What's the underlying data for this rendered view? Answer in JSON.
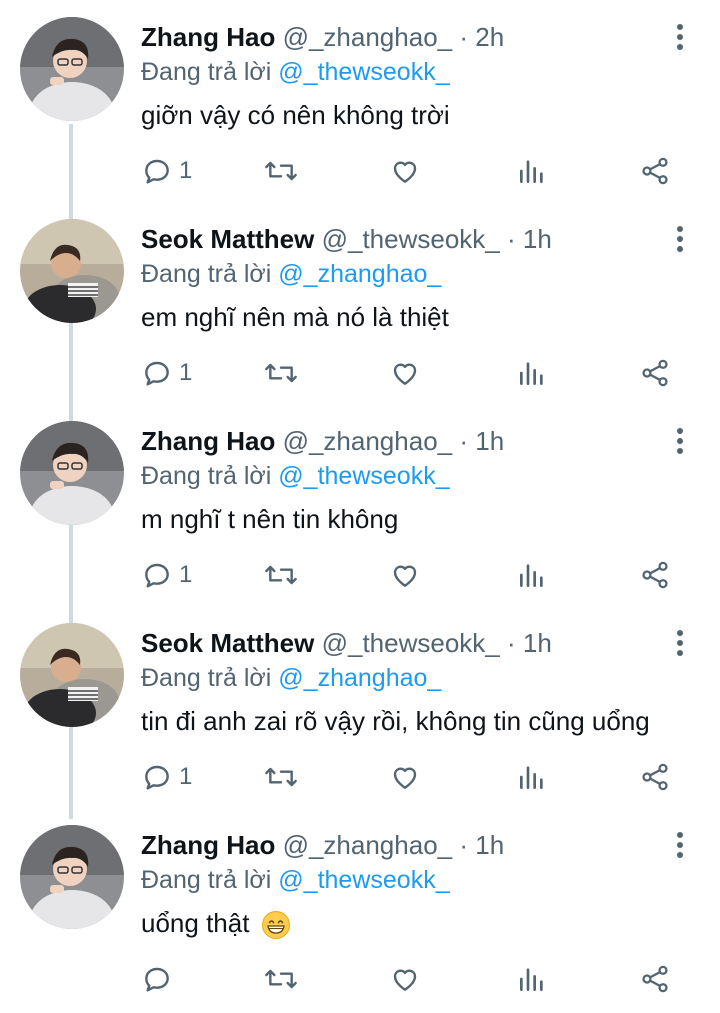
{
  "colors": {
    "accent": "#1d9bf0",
    "secondary_text": "#536471",
    "thread_line": "#cfd9de"
  },
  "reply_prefix": "Đang trả lời",
  "tweets": [
    {
      "name": "Zhang Hao",
      "handle": "@_zhanghao_",
      "separator": "·",
      "time": "2h",
      "replying_to": "@_thewseokk_",
      "text": "giỡn vậy có nên không trời",
      "reply_count": "1",
      "avatar": "zhang-hao-avatar"
    },
    {
      "name": "Seok Matthew",
      "handle": "@_thewseokk_",
      "separator": "·",
      "time": "1h",
      "replying_to": "@_zhanghao_",
      "text": "em nghĩ nên mà nó là thiệt",
      "reply_count": "1",
      "avatar": "seok-matthew-avatar"
    },
    {
      "name": "Zhang Hao",
      "handle": "@_zhanghao_",
      "separator": "·",
      "time": "1h",
      "replying_to": "@_thewseokk_",
      "text": "m nghĩ t nên tin không",
      "reply_count": "1",
      "avatar": "zhang-hao-avatar"
    },
    {
      "name": "Seok Matthew",
      "handle": "@_thewseokk_",
      "separator": "·",
      "time": "1h",
      "replying_to": "@_zhanghao_",
      "text": "tin đi anh zai rõ vậy rồi, không tin cũng uổng",
      "reply_count": "1",
      "avatar": "seok-matthew-avatar"
    },
    {
      "name": "Zhang Hao",
      "handle": "@_zhanghao_",
      "separator": "·",
      "time": "1h",
      "replying_to": "@_thewseokk_",
      "text": "uổng thật",
      "emoji": "😁",
      "reply_count": "",
      "avatar": "zhang-hao-avatar"
    }
  ],
  "icons": [
    "reply-icon",
    "retweet-icon",
    "like-icon",
    "analytics-icon",
    "share-icon",
    "more-options-icon",
    "grinning-emoji-icon"
  ]
}
